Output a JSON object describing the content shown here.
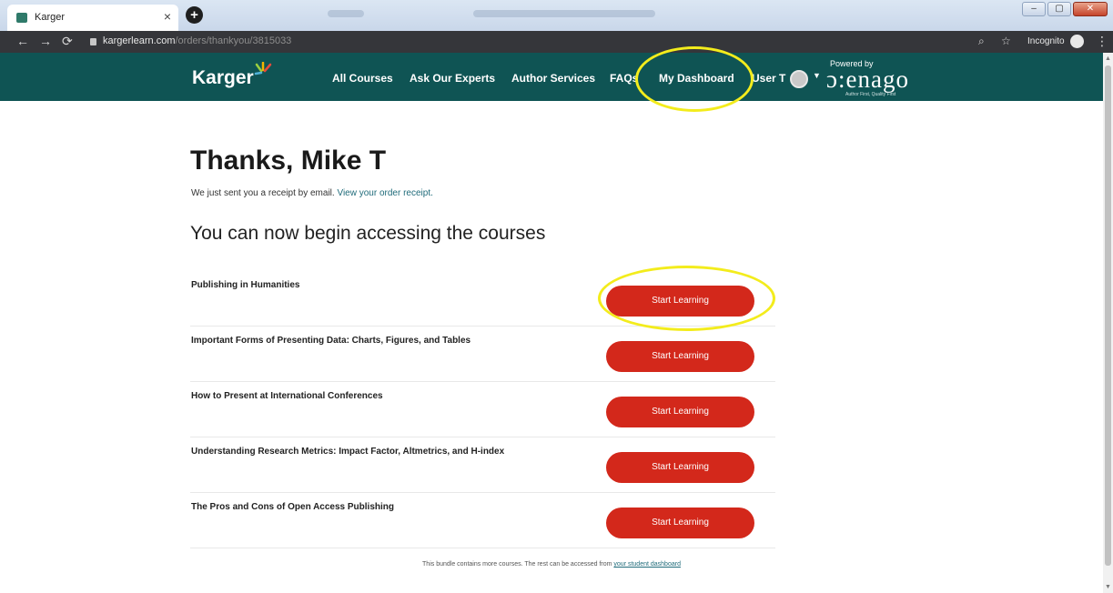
{
  "browser": {
    "tab_title": "Karger",
    "tab_close": "×",
    "new_tab": "+",
    "window_controls": [
      "–",
      "▢",
      "✕"
    ],
    "url_domain": "kargerlearn.com",
    "url_path": "/orders/thankyou/3815033",
    "incognito_label": "Incognito"
  },
  "header": {
    "logo_text": "Karger",
    "nav": [
      {
        "label": "All Courses"
      },
      {
        "label": "Ask Our Experts"
      },
      {
        "label": "Author Services"
      },
      {
        "label": "FAQs"
      },
      {
        "label": "My Dashboard"
      }
    ],
    "user_label": "User T",
    "powered_by": "Powered by",
    "partner_logo": "enago",
    "partner_tagline": "Author First, Quality First"
  },
  "page": {
    "title": "Thanks, Mike T",
    "receipt_text": "We just sent you a receipt by email.",
    "receipt_link": "View your order receipt.",
    "subtitle": "You can now begin accessing the courses",
    "courses": [
      {
        "title": "Publishing in Humanities",
        "button": "Start Learning"
      },
      {
        "title": "Important Forms of Presenting Data: Charts, Figures, and Tables",
        "button": "Start Learning"
      },
      {
        "title": "How to Present at International Conferences",
        "button": "Start Learning"
      },
      {
        "title": "Understanding Research Metrics: Impact Factor, Altmetrics, and H-index",
        "button": "Start Learning"
      },
      {
        "title": "The Pros and Cons of Open Access Publishing",
        "button": "Start Learning"
      }
    ],
    "footer_text": "This bundle contains more courses. The rest can be accessed from",
    "footer_link": "your student dashboard"
  },
  "colors": {
    "header_bg": "#0f5454",
    "button_red": "#d3281b",
    "highlight_yellow": "#f3ec1c",
    "link_teal": "#1f6b7a"
  }
}
